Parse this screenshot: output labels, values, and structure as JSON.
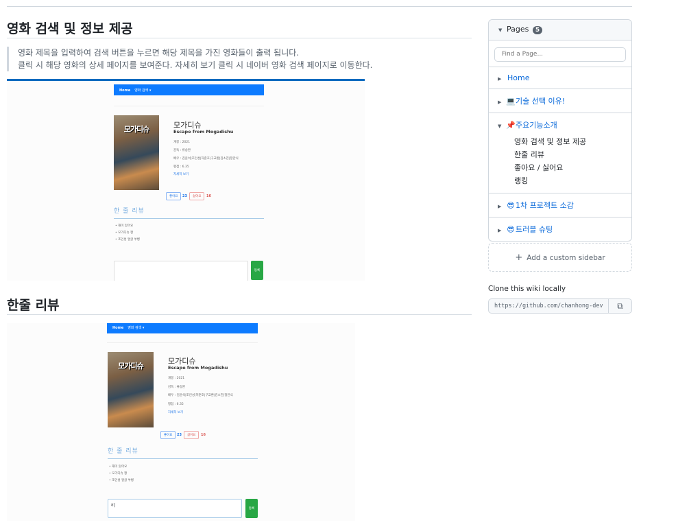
{
  "main": {
    "section1": {
      "title": "영화 검색 및 정보 제공",
      "quote_line1": "영화 제목을 입력하여 검색 버튼을 누르면 해당 제목을 가진 영화들이 출력 됩니다.",
      "quote_line2": "클릭 시 해당 영화의 상세 페이지를 보여준다. 자세히 보기 클릭 시 네이버 영화 검색 페이지로 이동한다."
    },
    "section2": {
      "title": "한줄 리뷰"
    },
    "screenshot": {
      "nav_brand": "Home",
      "nav_menu": "영화 검색 ▾",
      "poster_text": "모가디슈",
      "movie_title": "모가디슈",
      "movie_subtitle": "Escape from Mogadishu",
      "info": [
        "개봉 : 2021",
        "감독 : 류승완",
        "배우 : 김윤석|조인성|허준호|구교환|김소진|정만식",
        "평점 : 6.35"
      ],
      "detail_link": "자세히 보기",
      "like_label": "좋아요",
      "like_count": "23",
      "dislike_label": "싫어요",
      "dislike_count": "16",
      "review_heading": "한 줄 리뷰",
      "reviews": [
        "재미 있어요",
        "모가디슈 짱",
        "조인성 얼굴 쑤뻥"
      ],
      "submit_label": "등록",
      "typed_text": "ㅎ|"
    }
  },
  "sidebar": {
    "pages_label": "Pages",
    "pages_count": "5",
    "find_placeholder": "Find a Page...",
    "items": [
      {
        "label": "Home",
        "emoji": ""
      },
      {
        "label": "기술 선택 이유!",
        "emoji": "💻"
      },
      {
        "label": "주요기능소개",
        "emoji": "📌"
      },
      {
        "label": "1차 프로젝트 소감",
        "emoji": "😎"
      },
      {
        "label": "트러블 슈팅",
        "emoji": "😎"
      }
    ],
    "subitems": [
      "영화 검색 및 정보 제공",
      "한줄 리뷰",
      "좋아요 / 싫어요",
      "랭킹"
    ]
  },
  "add_sidebar_label": "Add a custom sidebar",
  "clone": {
    "label": "Clone this wiki locally",
    "url": "https://github.com/chanhong-dev/"
  }
}
